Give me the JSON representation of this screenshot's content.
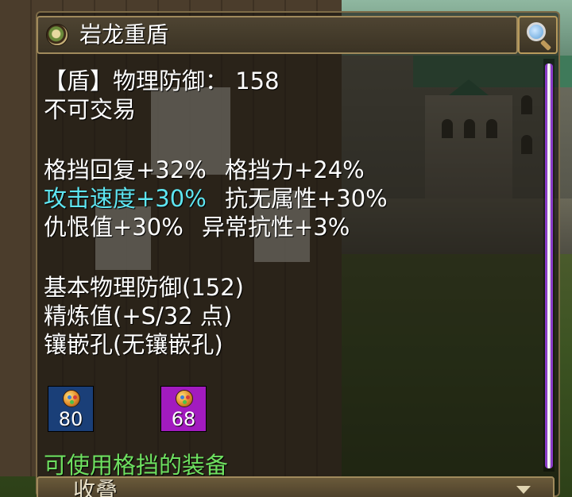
{
  "item": {
    "title": "岩龙重盾",
    "icon": "shield-item-icon"
  },
  "stats": {
    "defense_line": "【盾】物理防御： 158",
    "trade": "不可交易",
    "row1_a": "格挡回复+32%",
    "row1_b": "格挡力+24%",
    "row2_a": "攻击速度+30%",
    "row2_b": "抗无属性+30%",
    "row3_a": "仇恨值+30%",
    "row3_b": "异常抗性+3%",
    "base_defense": "基本物理防御(152)",
    "refine": "精炼值(+S/32 点)",
    "sockets": "镶嵌孔(无镶嵌孔)"
  },
  "gems": [
    {
      "value": "80",
      "color": "#1a3f78",
      "icon": "gem-orb-icon"
    },
    {
      "value": "68",
      "color": "#a21bbf",
      "icon": "gem-orb-icon"
    }
  ],
  "note": "可使用格挡的装备",
  "footer": {
    "collapse_label": "收叠"
  },
  "colors": {
    "highlight": "#5ee6f2",
    "usable_note": "#6ee060",
    "scroll_accent": "#8a3cc8"
  }
}
